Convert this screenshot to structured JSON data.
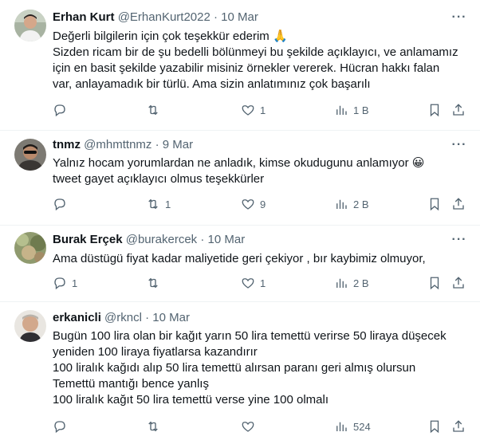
{
  "tweets": [
    {
      "name": "Erhan Kurt",
      "handle": "@ErhanKurt2022",
      "sep": "·",
      "date": "10 Mar",
      "lines": [
        "Değerli bilgilerin için çok teşekkür ederim 🙏",
        "Sizden ricam bir de şu bedelli bölünmeyi bu şekilde açıklayıcı, ve anlamamız",
        "için en basit şekilde yazabilir misiniz örnekler vererek. Hücran hakkı falan",
        "var, anlayamadık bir türlü. Ama sizin anlatımınız çok başarılı"
      ],
      "replies": "",
      "retweets": "",
      "likes": "1",
      "views": "1 B"
    },
    {
      "name": "tnmz",
      "handle": "@mhmttnmz",
      "sep": "·",
      "date": "9 Mar",
      "lines": [
        "Yalnız hocam yorumlardan ne anladık, kimse okudugunu anlamıyor 😀",
        "tweet gayet açıklayıcı olmus teşekkürler"
      ],
      "replies": "",
      "retweets": "1",
      "likes": "9",
      "views": "2 B"
    },
    {
      "name": "Burak Erçek",
      "handle": "@burakercek",
      "sep": "·",
      "date": "10 Mar",
      "lines": [
        "Ama düstügü fiyat kadar maliyetide geri çekiyor , bır kaybimiz olmuyor,"
      ],
      "replies": "1",
      "retweets": "",
      "likes": "1",
      "views": "2 B"
    },
    {
      "name": "erkanicli",
      "handle": "@rkncl",
      "sep": "·",
      "date": "10 Mar",
      "lines": [
        "Bugün 100 lira olan bir kağıt yarın 50 lira temettü verirse 50 liraya düşecek",
        "yeniden 100 liraya fiyatlarsa kazandırır",
        "100 liralık kağıdı alıp 50 lira temettü alırsan paranı geri almış olursun",
        "Temettü mantığı bence yanlış",
        "100 liralık kağıt 50 lira temettü verse yine 100 olmalı"
      ],
      "replies": "",
      "retweets": "",
      "likes": "",
      "views": "524"
    }
  ],
  "more_label": "···",
  "icons": {
    "reply": "reply-icon",
    "retweet": "retweet-icon",
    "like": "heart-icon",
    "views": "views-bar-chart-icon",
    "bookmark": "bookmark-icon",
    "share": "share-icon"
  },
  "colors": {
    "text": "#0f1419",
    "secondary": "#536471",
    "divider": "#eff3f4"
  }
}
